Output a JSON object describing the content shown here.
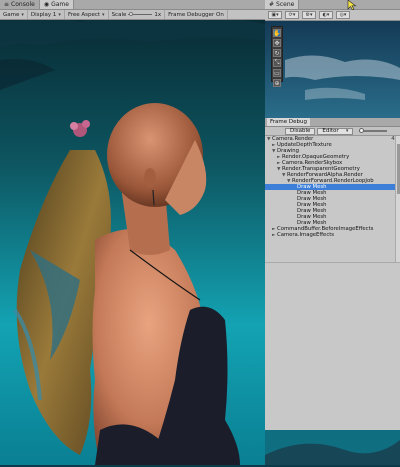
{
  "game_tabs": [
    {
      "label": "Console",
      "icon": "console-icon"
    },
    {
      "label": "Game",
      "icon": "game-icon"
    }
  ],
  "game_toolbar": {
    "display_mode": "Game",
    "display": "Display 1",
    "aspect": "Free Aspect",
    "scale_label": "Scale",
    "scale_value": "1x",
    "frame_debugger": "Frame Debugger On"
  },
  "scene_panel": {
    "tab_label": "Scene",
    "tools": [
      "hand-tool-icon",
      "move-tool-icon",
      "rotate-tool-icon",
      "scale-tool-icon",
      "rect-tool-icon",
      "transform-tool-icon"
    ]
  },
  "frame_debugger": {
    "tab_label": "Frame Debug",
    "disable_label": "Disable",
    "target_label": "Editor",
    "tree": [
      {
        "label": "Camera.Render",
        "depth": 0,
        "arrow": "▼",
        "count": "43"
      },
      {
        "label": "UpdateDepthTexture",
        "depth": 1,
        "arrow": "►",
        "count": "6"
      },
      {
        "label": "Drawing",
        "depth": 1,
        "arrow": "▼",
        "count": "2"
      },
      {
        "label": "Render.OpaqueGeometry",
        "depth": 2,
        "arrow": "►",
        "count": "2"
      },
      {
        "label": "Camera.RenderSkybox",
        "depth": 2,
        "arrow": "►",
        "count": ""
      },
      {
        "label": "Render.TransparentGeometry",
        "depth": 2,
        "arrow": "▼",
        "count": ""
      },
      {
        "label": "RenderForwardAlpha.Render",
        "depth": 3,
        "arrow": "▼",
        "count": ""
      },
      {
        "label": "RenderForward.RenderLoopJob",
        "depth": 4,
        "arrow": "▼",
        "count": ""
      },
      {
        "label": "Draw Mesh",
        "depth": 5,
        "arrow": "",
        "count": "",
        "selected": true
      },
      {
        "label": "Draw Mesh",
        "depth": 5,
        "arrow": "",
        "count": ""
      },
      {
        "label": "Draw Mesh",
        "depth": 5,
        "arrow": "",
        "count": ""
      },
      {
        "label": "Draw Mesh",
        "depth": 5,
        "arrow": "",
        "count": ""
      },
      {
        "label": "Draw Mesh",
        "depth": 5,
        "arrow": "",
        "count": ""
      },
      {
        "label": "Draw Mesh",
        "depth": 5,
        "arrow": "",
        "count": ""
      },
      {
        "label": "Draw Mesh",
        "depth": 5,
        "arrow": "",
        "count": ""
      },
      {
        "label": "CommandBuffer.BeforeImageEffects",
        "depth": 1,
        "arrow": "►",
        "count": ""
      },
      {
        "label": "Camera.ImageEffects",
        "depth": 1,
        "arrow": "►",
        "count": ""
      }
    ]
  },
  "colors": {
    "selection": "#3d7fd8",
    "panel_bg": "#c8c8c8",
    "sky_top": "#0a2f3a",
    "sky_bottom": "#1bb0c0"
  }
}
